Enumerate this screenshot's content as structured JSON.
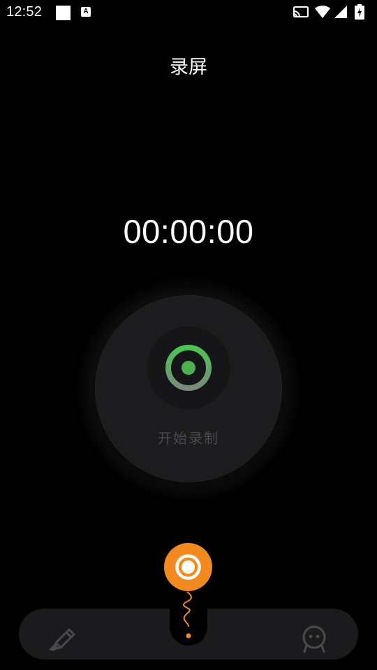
{
  "status_bar": {
    "time": "12:52",
    "icons": [
      "notification-square-icon",
      "a-badge-icon",
      "cast-icon",
      "wifi-icon",
      "signal-icon",
      "battery-charging-icon"
    ],
    "a_glyph": "A"
  },
  "header": {
    "title": "录屏"
  },
  "timer": {
    "value": "00:00:00"
  },
  "record": {
    "label": "开始录制",
    "icon": "record-target-icon",
    "accent_color": "#4caf50"
  },
  "bottom_bar": {
    "left_icon": "pen-icon",
    "right_icon": "face-icon",
    "fab_icon": "record-ring-icon",
    "fab_color": "#f28a20"
  }
}
